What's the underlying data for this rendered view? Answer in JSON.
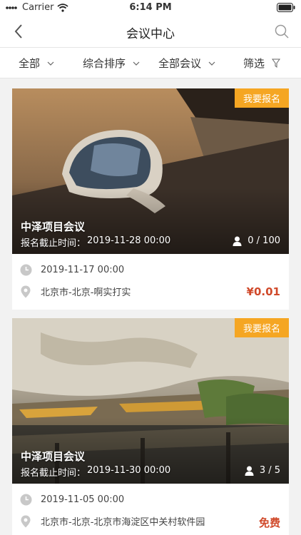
{
  "status_bar": {
    "carrier": "Carrier",
    "time": "6:14 PM"
  },
  "nav": {
    "title": "会议中心"
  },
  "filters": [
    {
      "label": "全部"
    },
    {
      "label": "综合排序"
    },
    {
      "label": "全部会议"
    },
    {
      "label": "筛选"
    }
  ],
  "meetings": [
    {
      "badge": "我要报名",
      "title": "中泽项目会议",
      "deadline_label": "报名截止时间：",
      "deadline": "2019-11-28 00:00",
      "attendance": "0 / 100",
      "start_time": "2019-11-17 00:00",
      "location": "北京市-北京-啊实打实",
      "price": "¥0.01"
    },
    {
      "badge": "我要报名",
      "title": "中泽项目会议",
      "deadline_label": "报名截止时间：",
      "deadline": "2019-11-30 00:00",
      "attendance": "3 / 5",
      "start_time": "2019-11-05 00:00",
      "location": "北京市-北京-北京市海淀区中关村软件园",
      "price": "免费"
    }
  ],
  "colors": {
    "badge": "#f5a623",
    "price": "#d0492a"
  }
}
